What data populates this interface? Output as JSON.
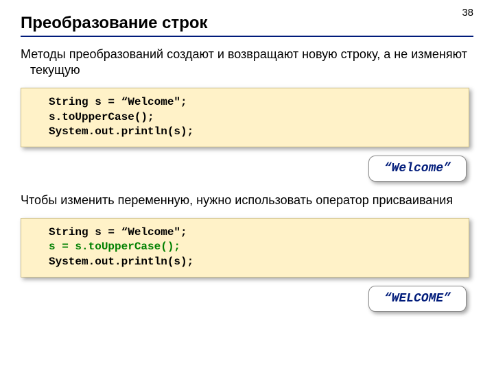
{
  "page_number": "38",
  "title": "Преобразование строк",
  "para1": "Методы преобразований создают и возвращают новую строку, а не изменяют текущую",
  "code1": {
    "l1": "String s = “Welcome\";",
    "l2": "s.toUpperCase();",
    "l3": "System.out.println(s);"
  },
  "output1": "“Welcome”",
  "para2": "Чтобы изменить переменную, нужно использовать оператор присваивания",
  "code2": {
    "l1": "String s = “Welcome\";",
    "l2": "s = s.toUpperCase();",
    "l3": "System.out.println(s);"
  },
  "output2": "“WELCOME”"
}
